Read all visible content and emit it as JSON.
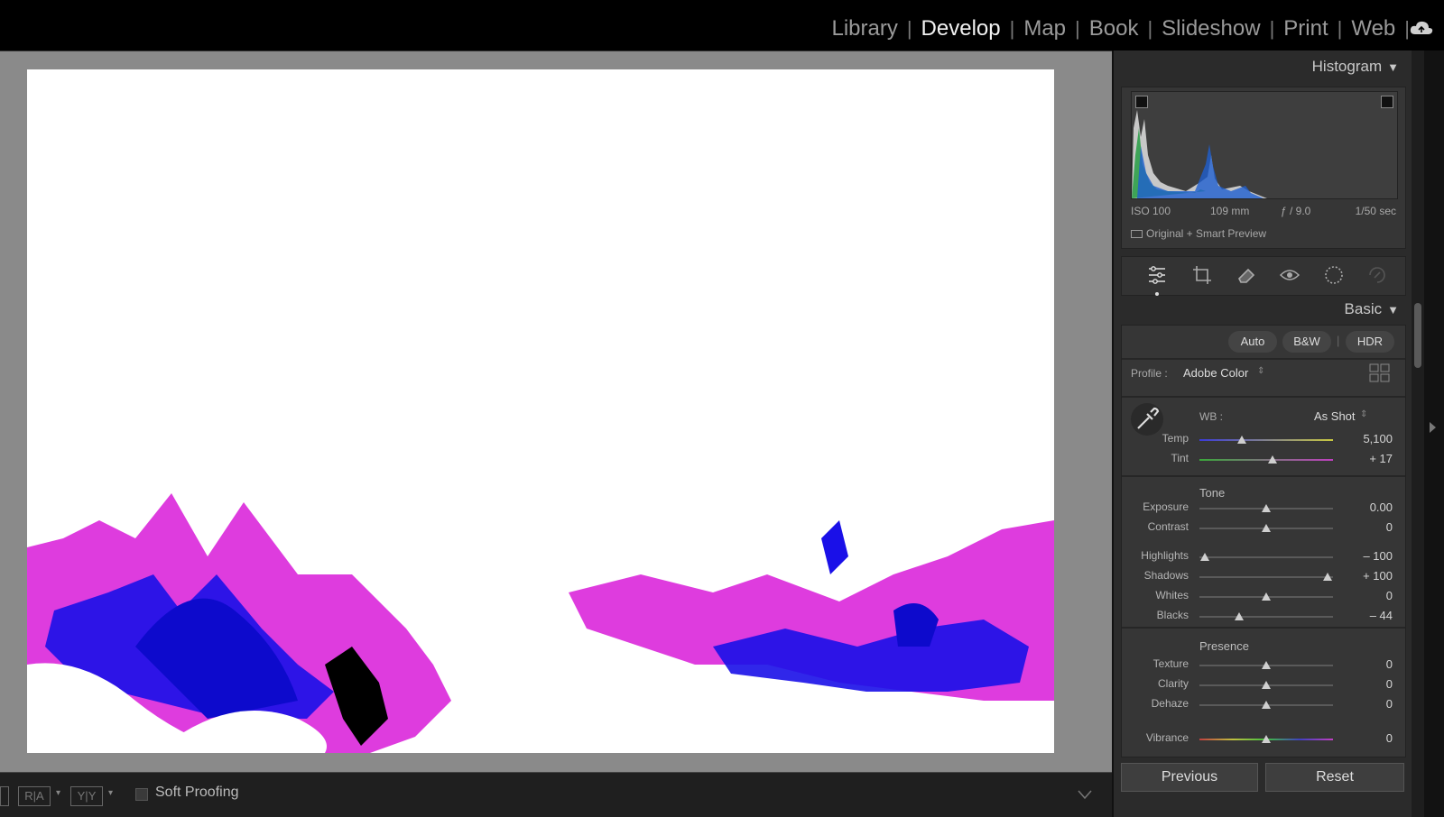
{
  "modules": [
    "Library",
    "Develop",
    "Map",
    "Book",
    "Slideshow",
    "Print",
    "Web"
  ],
  "active_module": "Develop",
  "toolbar": {
    "view_box_1": "R|A",
    "view_box_2": "Y|Y",
    "soft_proofing_label": "Soft Proofing"
  },
  "histogram": {
    "title": "Histogram",
    "iso": "ISO 100",
    "focal": "109 mm",
    "aperture": "ƒ / 9.0",
    "shutter": "1/50 sec",
    "preview": "Original + Smart Preview"
  },
  "basic": {
    "title": "Basic",
    "auto": "Auto",
    "bw": "B&W",
    "hdr": "HDR",
    "profile_label": "Profile :",
    "profile_value": "Adobe Color",
    "wb_label": "WB :",
    "wb_value": "As Shot",
    "tone_heading": "Tone",
    "presence_heading": "Presence",
    "sliders": [
      {
        "label": "Temp",
        "value": "5,100",
        "pos": 0.32
      },
      {
        "label": "Tint",
        "value": "+ 17",
        "pos": 0.55
      },
      {
        "label": "Exposure",
        "value": "0.00",
        "pos": 0.5
      },
      {
        "label": "Contrast",
        "value": "0",
        "pos": 0.5
      },
      {
        "label": "Highlights",
        "value": "– 100",
        "pos": 0.04
      },
      {
        "label": "Shadows",
        "value": "+ 100",
        "pos": 0.96
      },
      {
        "label": "Whites",
        "value": "0",
        "pos": 0.5
      },
      {
        "label": "Blacks",
        "value": "– 44",
        "pos": 0.3
      },
      {
        "label": "Texture",
        "value": "0",
        "pos": 0.5
      },
      {
        "label": "Clarity",
        "value": "0",
        "pos": 0.5
      },
      {
        "label": "Dehaze",
        "value": "0",
        "pos": 0.5
      },
      {
        "label": "Vibrance",
        "value": "0",
        "pos": 0.5
      }
    ]
  },
  "buttons": {
    "previous": "Previous",
    "reset": "Reset"
  },
  "colors": {
    "accent_magenta": "#e010e0",
    "accent_blue": "#1a10f0"
  }
}
